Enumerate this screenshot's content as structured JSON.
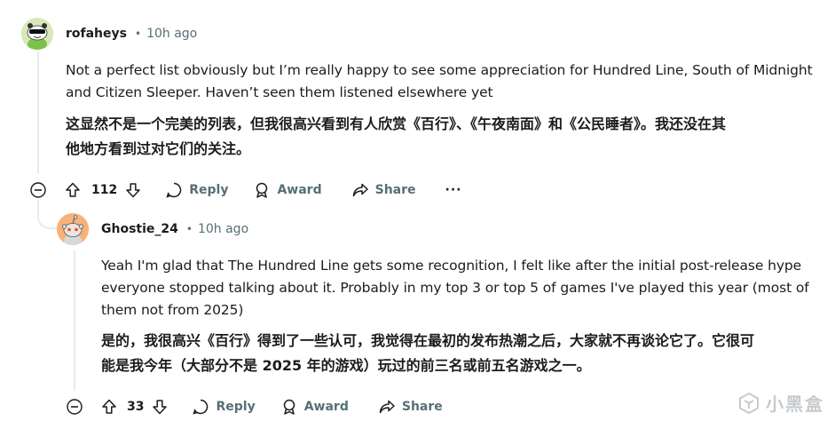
{
  "comments": [
    {
      "username": "rofaheys",
      "separator": "•",
      "time": "10h ago",
      "body_en": [
        "Not a perfect list obviously but I’m really happy to see some appreciation for Hundred Line, South of Midnight",
        "and Citizen Sleeper. Haven’t seen them listened elsewhere yet"
      ],
      "body_zh": [
        "这显然不是一个完美的列表，但我很高兴看到有人欣赏《百行》、《午夜南面》和《公民睡者》。我还没在其",
        "他地方看到过对它们的关注。"
      ],
      "votes": "112",
      "reply_label": "Reply",
      "award_label": "Award",
      "share_label": "Share",
      "more_label": "···",
      "avatar_icon": "snoo-sunglasses-avatar"
    },
    {
      "username": "Ghostie_24",
      "separator": "•",
      "time": "10h ago",
      "body_en": [
        "Yeah I'm glad that The Hundred Line gets some recognition, I felt like after the initial post-release hype",
        "everyone stopped talking about it. Probably in my top 3 or top 5 of games I've played this year (most of",
        "them not from 2025)"
      ],
      "body_zh": [
        "是的，我很高兴《百行》得到了一些认可，我觉得在最初的发布热潮之后，大家就不再谈论它了。它很可",
        "能是我今年（大部分不是 2025 年的游戏）玩过的前三名或前五名游戏之一。"
      ],
      "votes": "33",
      "reply_label": "Reply",
      "award_label": "Award",
      "share_label": "Share",
      "avatar_icon": "snoo-orange-avatar"
    }
  ],
  "watermark": {
    "text": "小黑盒",
    "icon": "heybox-logo-icon"
  },
  "colors": {
    "text": "#1c1c1c",
    "meta": "#576f76",
    "thread_line": "#e5ebee",
    "avatar1_bg": "#d8e8b8",
    "avatar2_bg": "#f7b27a"
  }
}
